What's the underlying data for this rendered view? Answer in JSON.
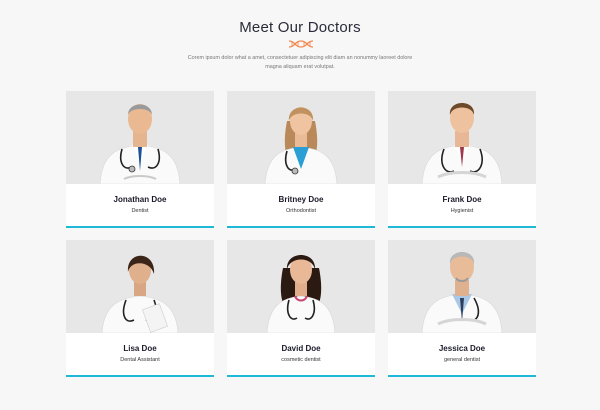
{
  "section": {
    "title": "Meet Our Doctors",
    "intro": "Corem ipsum dolor what a amet, consectetuer adipiscing elit diam an nonummy laoreet dolore magna aliquam erat volutpat."
  },
  "colors": {
    "accent": "#1fb8d6",
    "dna_icon": "#f0894f",
    "photo_bg": "#e7e7e7"
  },
  "doctors": [
    {
      "name": "Jonathan Doe",
      "role": "Dentist",
      "icon": "doctor-male-senior"
    },
    {
      "name": "Britney Doe",
      "role": "Orthodontist",
      "icon": "doctor-female"
    },
    {
      "name": "Frank Doe",
      "role": "Hygienist",
      "icon": "doctor-male-young"
    },
    {
      "name": "Lisa Doe",
      "role": "Dental Assistant",
      "icon": "doctor-female"
    },
    {
      "name": "David Doe",
      "role": "cosmetic dentist",
      "icon": "doctor-female"
    },
    {
      "name": "Jessica Doe",
      "role": "general dentist",
      "icon": "doctor-male-senior"
    }
  ]
}
